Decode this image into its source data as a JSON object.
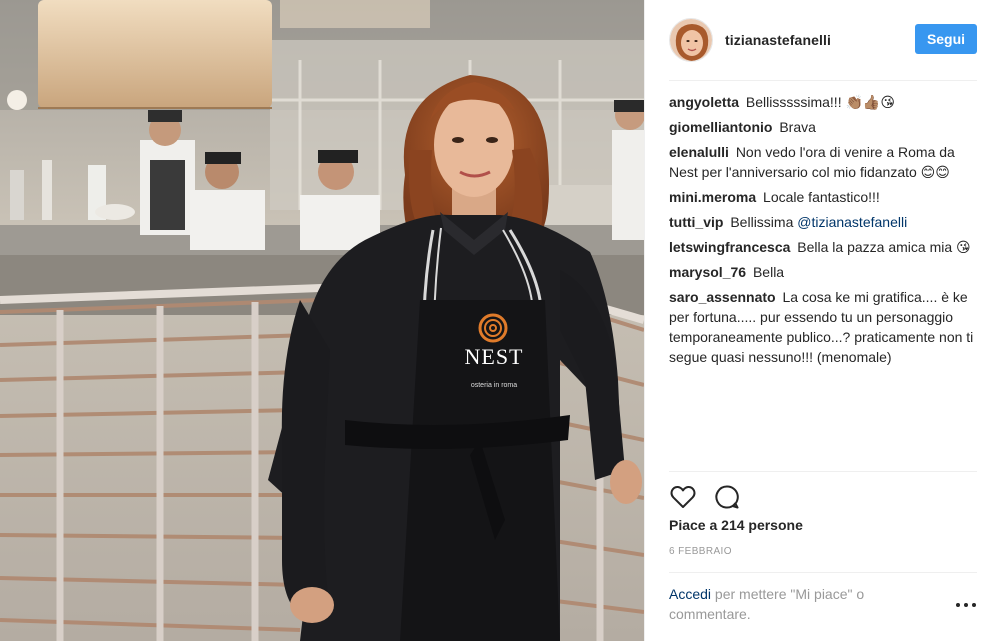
{
  "post": {
    "username": "tizianastefanelli",
    "follow_label": "Segui",
    "apron_logo": "NEST",
    "apron_sub": "osteria in roma"
  },
  "comments": [
    {
      "user": "angyoletta",
      "text": "Bellisssssima!!! 👏🏽👍🏽😘"
    },
    {
      "user": "giomelliantonio",
      "text": "Brava"
    },
    {
      "user": "elenalulli",
      "text": "Non vedo l'ora di venire a Roma da Nest per l'anniversario col mio fidanzato 😊😊"
    },
    {
      "user": "mini.meroma",
      "text": "Locale fantastico!!!"
    },
    {
      "user": "tutti_vip",
      "text": "Bellissima",
      "mention": "@tizianastefanelli"
    },
    {
      "user": "letswingfrancesca",
      "text": "Bella la pazza amica mia 😘"
    },
    {
      "user": "marysol_76",
      "text": "Bella"
    },
    {
      "user": "saro_assennato",
      "text": "La cosa ke mi gratifica.... è ke per fortuna..... pur essendo tu un personaggio temporaneamente publico...? praticamente non ti segue quasi nessuno!!! (menomale)"
    }
  ],
  "footer": {
    "likes": "Piace a 214 persone",
    "date": "6 FEBBRAIO",
    "login_link": "Accedi",
    "login_rest": " per mettere \"Mi piace\" o commentare."
  },
  "icons": {
    "like": "heart-outline-icon",
    "comment": "speech-bubble-icon",
    "more": "ellipsis-icon"
  },
  "colors": {
    "accent": "#3897f0",
    "link": "#003569",
    "muted": "#999999",
    "apron_accent": "#e07b2a"
  }
}
